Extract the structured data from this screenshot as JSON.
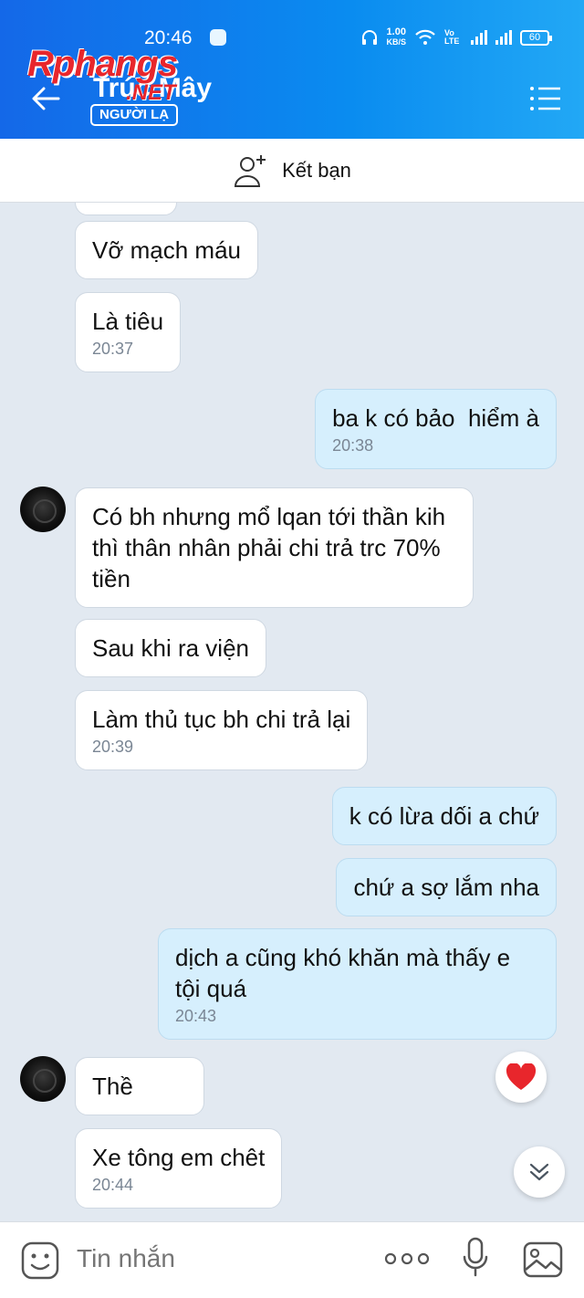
{
  "status_bar": {
    "time": "20:46",
    "net_speed_value": "1.00",
    "net_speed_unit": "KB/S",
    "volte": "Vo LTE",
    "battery": "60"
  },
  "header": {
    "contact_name": "Trúc Mây",
    "badge": "NGƯỜI LẠ",
    "watermark": "Rphangs",
    "watermark_suffix": ".NET"
  },
  "add_friend": {
    "label": "Kết bạn"
  },
  "messages": [
    {
      "side": "in",
      "text": "Vỡ mạch máu",
      "time": ""
    },
    {
      "side": "in",
      "text": "Là tiêu",
      "time": "20:37"
    },
    {
      "side": "out",
      "text": "ba k có bảo  hiểm à",
      "time": "20:38"
    },
    {
      "side": "in",
      "text": "Có bh nhưng mổ lqan tới thần kih thì thân nhân phải chi trả trc 70% tiền",
      "time": ""
    },
    {
      "side": "in",
      "text": "Sau khi ra viện",
      "time": ""
    },
    {
      "side": "in",
      "text": "Làm thủ tục bh chi trả lại",
      "time": "20:39"
    },
    {
      "side": "out",
      "text": "k có lừa dối a chứ",
      "time": ""
    },
    {
      "side": "out",
      "text": "chứ a sợ lắm nha",
      "time": ""
    },
    {
      "side": "out",
      "text": "dịch a cũng khó khăn mà thấy e tội quá",
      "time": "20:43"
    },
    {
      "side": "in",
      "text": "Thề",
      "time": ""
    },
    {
      "side": "in",
      "text": "Xe tông em chêt",
      "time": "20:44"
    }
  ],
  "composer": {
    "placeholder": "Tin nhắn"
  },
  "colors": {
    "header_start": "#1468e8",
    "header_end": "#22a8f5",
    "out_bubble": "#d6effd",
    "in_bubble": "#ffffff",
    "chat_bg": "#e2e9f1",
    "heart": "#e8262c"
  }
}
